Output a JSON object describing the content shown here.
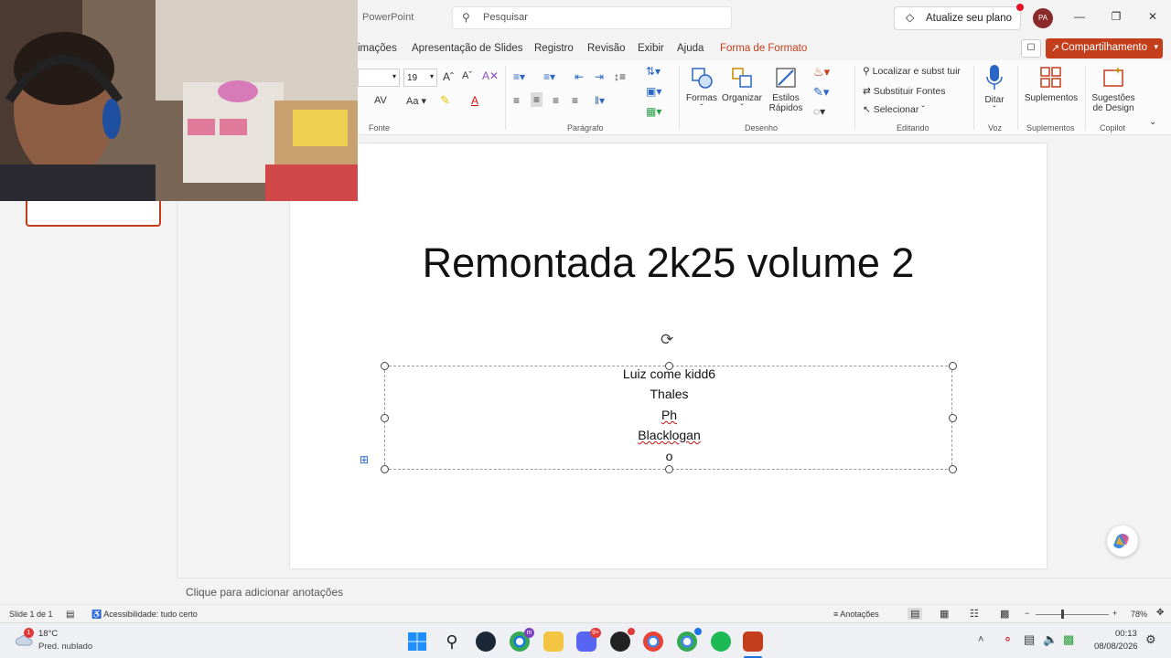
{
  "titlebar": {
    "app_name": "PowerPoint",
    "search_placeholder": "Pesquisar",
    "upgrade_label": "Atualize seu plano",
    "avatar_initials": "PA"
  },
  "menu": {
    "items": [
      "imações",
      "Apresentação de Slides",
      "Registro",
      "Revisão",
      "Exibir",
      "Ajuda",
      "Forma de Formato"
    ],
    "active_index": 6,
    "share_label": "Compartilhamento"
  },
  "ribbon": {
    "font_size": "19",
    "groups": [
      "Fonte",
      "Parágrafo",
      "Desenho",
      "Editando",
      "Voz",
      "Suplementos",
      "Copilot"
    ],
    "drawing": {
      "shapes": "Formas",
      "arrange": "Organizar",
      "styles_1": "Estilos",
      "styles_2": "Rápidos"
    },
    "editing": {
      "find": "Localizar e subst tuir",
      "replace_fonts": "Substituir Fontes",
      "select": "Selecionar"
    },
    "voice": {
      "dictate": "Ditar"
    },
    "addins": {
      "label": "Suplementos"
    },
    "copilot": {
      "line1": "Sugestões",
      "line2": "de Design"
    }
  },
  "slide": {
    "title": "Remontada 2k25 volume 2",
    "lines": [
      "Luiz come kidd6",
      "Thales",
      "Ph",
      "Blacklogan",
      "o"
    ]
  },
  "notes": {
    "placeholder": "Clique para adicionar anotações"
  },
  "status": {
    "slide_counter": "Slide 1 de 1",
    "accessibility": "Acessibilidade: tudo certo",
    "notes_btn": "Anotações",
    "zoom": "78%"
  },
  "taskbar": {
    "weather_temp": "18°C",
    "weather_desc": "Pred. nublado",
    "weather_badge": "1",
    "time": "00:13",
    "date": "08/08/2026",
    "discord_badge": "9+"
  },
  "colors": {
    "accent": "#c43e1c",
    "slide_bg": "#ffffff",
    "app_bg": "#f3f3f3"
  }
}
